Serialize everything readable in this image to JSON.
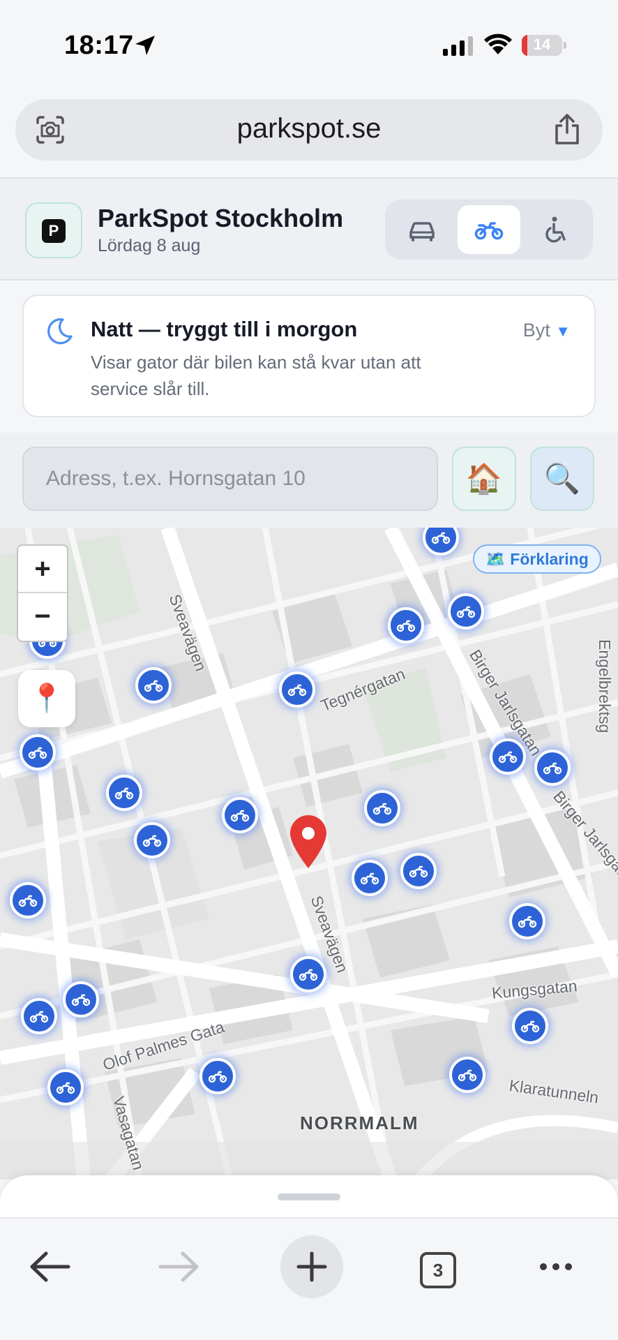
{
  "status_bar": {
    "time": "18:17",
    "battery": "14"
  },
  "browser": {
    "url": "parkspot.se",
    "tab_count": "3"
  },
  "header": {
    "logo_letter": "P",
    "title": "ParkSpot Stockholm",
    "date": "Lördag 8 aug",
    "modes": [
      {
        "name": "car",
        "icon": "car-icon",
        "active": false
      },
      {
        "name": "motorcycle",
        "icon": "motorcycle-icon",
        "active": true
      },
      {
        "name": "accessible",
        "icon": "wheelchair-icon",
        "active": false
      }
    ]
  },
  "banner": {
    "icon": "moon-icon",
    "title": "Natt — tryggt till i morgon",
    "description": "Visar gator där bilen kan stå kvar utan att service slår till.",
    "switch_label": "Byt",
    "switch_caret": "▼"
  },
  "search": {
    "placeholder": "Adress, t.ex. Hornsgatan 10",
    "home_icon": "🏠",
    "search_icon": "🔍"
  },
  "map": {
    "zoom_in": "+",
    "zoom_out": "−",
    "locate_icon": "📍",
    "legend_label": "🗺️ Förklaring",
    "district": "NORRMALM",
    "street_labels": [
      "Sveavägen",
      "Tegnérgatan",
      "Birger Jarlsgatan",
      "Birger Jarlsgatan",
      "Sveavägen",
      "Olof Palmes Gata",
      "Kungsgatan",
      "Klaratunneln",
      "Vasagatan",
      "Engelbrektsg"
    ],
    "pin_color": "#2d63d6",
    "marker_color": "#e53935"
  },
  "colors": {
    "accent": "#3b82f6",
    "battery_low": "#e53935"
  }
}
